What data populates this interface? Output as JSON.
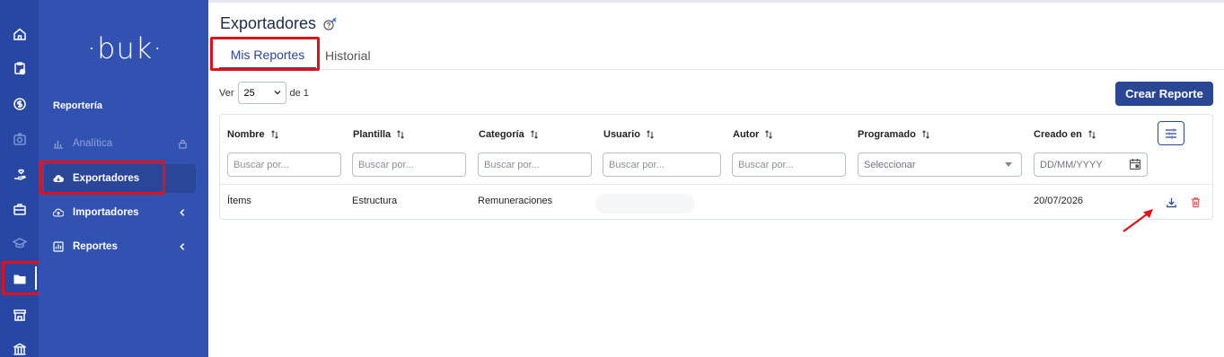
{
  "rail": {
    "items": [
      {
        "icon": "home-icon"
      },
      {
        "icon": "clipboard-clock-icon"
      },
      {
        "icon": "dollar-circle-icon"
      },
      {
        "icon": "camera-icon"
      },
      {
        "icon": "hand-heart-icon"
      },
      {
        "icon": "briefcase-icon"
      },
      {
        "icon": "graduation-cap-icon"
      },
      {
        "icon": "folder-icon"
      },
      {
        "icon": "store-icon"
      },
      {
        "icon": "bank-icon"
      }
    ],
    "active_index": 7,
    "active_color": "#ffffff",
    "background": "#2648a4"
  },
  "sidebar": {
    "logo": "·buk·",
    "section_title": "Reportería",
    "items": [
      {
        "label": "Analítica",
        "icon": "bar-chart-icon",
        "state": "disabled",
        "right_icon": "lock-icon"
      },
      {
        "label": "Exportadores",
        "icon": "cloud-download-icon",
        "state": "active"
      },
      {
        "label": "Importadores",
        "icon": "cloud-upload-icon",
        "state": "normal",
        "right_icon": "chevron-left-icon"
      },
      {
        "label": "Reportes",
        "icon": "report-icon",
        "state": "normal",
        "right_icon": "chevron-left-icon"
      }
    ],
    "background": "#3152b0"
  },
  "header": {
    "title": "Exportadores",
    "help_icon": "help-pin-icon"
  },
  "tabs": [
    {
      "label": "Mis Reportes",
      "active": true
    },
    {
      "label": "Historial",
      "active": false
    }
  ],
  "pager": {
    "prefix": "Ver",
    "page_size": "25",
    "of_label": "de 1"
  },
  "create_button": "Crear Reporte",
  "table": {
    "columns": [
      {
        "label": "Nombre",
        "filter_placeholder": "Buscar por..."
      },
      {
        "label": "Plantilla",
        "filter_placeholder": "Buscar por..."
      },
      {
        "label": "Categoría",
        "filter_placeholder": "Buscar por..."
      },
      {
        "label": "Usuario",
        "filter_placeholder": "Buscar por..."
      },
      {
        "label": "Autor",
        "filter_placeholder": "Buscar por..."
      },
      {
        "label": "Programado",
        "filter_placeholder": "Seleccionar"
      },
      {
        "label": "Creado en",
        "filter_placeholder": "DD/MM/YYYY"
      }
    ],
    "rows": [
      {
        "nombre": "Ítems",
        "plantilla": "Estructura",
        "categoria": "Remuneraciones",
        "usuario": "",
        "autor": "",
        "programado": "",
        "creado_en": "20/07/2026"
      }
    ]
  },
  "colors": {
    "primary": "#2a4796",
    "danger": "#e05a5a",
    "highlight": "#e3101a"
  }
}
